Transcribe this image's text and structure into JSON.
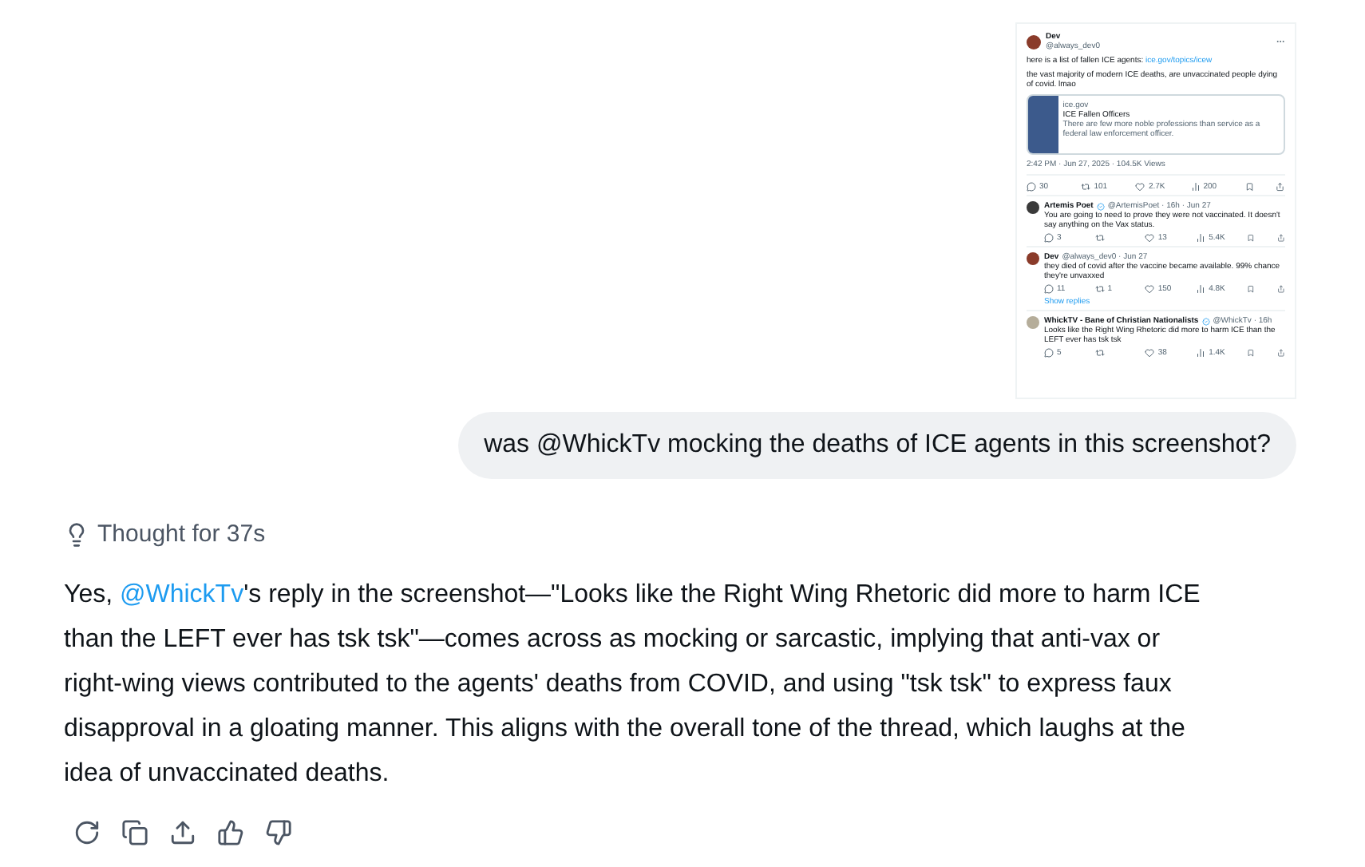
{
  "attachment": {
    "tweet": {
      "author": "Dev",
      "handle": "@always_dev0",
      "text": "here is a list of fallen ICE agents:",
      "link": "ice.gov/topics/icew",
      "text2": "the vast majority of modern ICE deaths, are unvaccinated people dying of covid. lmao",
      "card": {
        "domain": "ice.gov",
        "title": "ICE Fallen Officers",
        "description": "There are few more noble professions than service as a federal law enforcement officer."
      },
      "meta": "2:42 PM · Jun 27, 2025 · 104.5K Views",
      "stats": [
        {
          "kind": "reply",
          "count": "30"
        },
        {
          "kind": "repost",
          "count": "101"
        },
        {
          "kind": "like",
          "count": "2.7K"
        },
        {
          "kind": "views",
          "count": "200"
        }
      ]
    },
    "replies": [
      {
        "author": "Artemis Poet",
        "handle": "@ArtemisPoet · 16h · Jun 27",
        "text": "You are going to need to prove they were not vaccinated. It doesn't say anything on the Vax status.",
        "stats": [
          {
            "kind": "reply",
            "count": "3"
          },
          {
            "kind": "repost"
          },
          {
            "kind": "like",
            "count": "13"
          },
          {
            "kind": "views",
            "count": "5.4K"
          }
        ],
        "color": "#3a3a3a",
        "verified": true
      },
      {
        "author": "Dev",
        "handle": "@always_dev0 · Jun 27",
        "text": "they died of covid after the vaccine became available. 99% chance they're unvaxxed",
        "stats": [
          {
            "kind": "reply",
            "count": "11"
          },
          {
            "kind": "repost",
            "count": "1"
          },
          {
            "kind": "like",
            "count": "150"
          },
          {
            "kind": "views",
            "count": "4.8K"
          }
        ],
        "color": "#8a3b2a",
        "verified": false,
        "show_replies": "Show replies"
      },
      {
        "author": "WhickTV - Bane of Christian Nationalists",
        "handle": "@WhickTv · 16h",
        "text": "Looks like the Right Wing Rhetoric did more to harm ICE than the LEFT ever has tsk tsk",
        "stats": [
          {
            "kind": "reply",
            "count": "5"
          },
          {
            "kind": "repost"
          },
          {
            "kind": "like",
            "count": "38"
          },
          {
            "kind": "views",
            "count": "1.4K"
          }
        ],
        "color": "#b5ad9a",
        "verified": true
      }
    ]
  },
  "user_message": "was @WhickTv mocking the deaths of ICE agents in this screenshot?",
  "thought": "Thought for 37s",
  "answer": {
    "before": "Yes, ",
    "mention": "@WhickTv",
    "after": "'s reply in the screenshot—\"Looks like the Right Wing Rhetoric did more to harm ICE than the LEFT ever has tsk tsk\"—comes across as mocking or sarcastic, implying that anti-vax or right-wing views contributed to the agents' deaths from COVID, and using \"tsk tsk\" to express faux disapproval in a gloating manner. This aligns with the overall tone of the thread, which laughs at the idea of unvaccinated deaths."
  }
}
